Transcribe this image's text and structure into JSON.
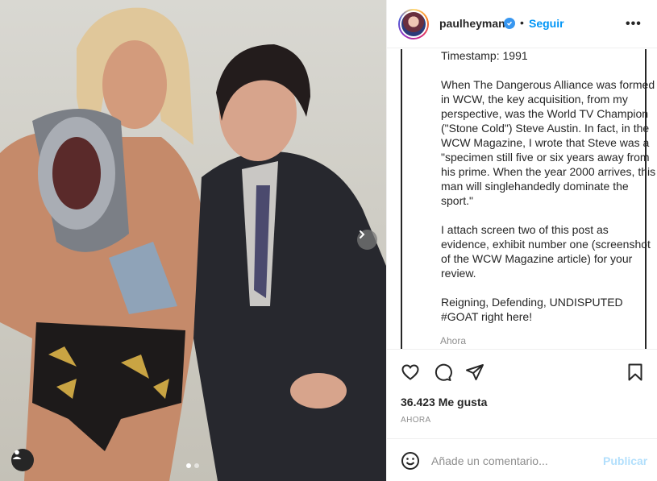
{
  "post": {
    "image_alt": "Two men posing; one holding a championship belt",
    "carousel_dots": 2,
    "active_dot": 0
  },
  "header": {
    "username": "paulheyman",
    "verified": true,
    "separator": "•",
    "follow_label": "Seguir",
    "more_label": "•••"
  },
  "caption": {
    "text": "Timestamp: 1991\n\nWhen The Dangerous Alliance was formed in WCW, the key acquisition, from my perspective, was the World TV Champion (\"Stone Cold\") Steve Austin. In fact, in the WCW Magazine, I wrote that Steve was a \"specimen still five or six years away from his prime. When the year 2000 arrives, this man will singlehandedly dominate the sport.\"\n\nI attach screen two of this post as evidence, exhibit number one (screenshot of the WCW Magazine article) for your review.\n\nReigning, Defending, UNDISPUTED #GOAT right here!",
    "time": "Ahora"
  },
  "actions": {
    "like_icon": "heart-icon",
    "comment_icon": "comment-icon",
    "share_icon": "share-icon",
    "save_icon": "bookmark-icon"
  },
  "likes": "36.423 Me gusta",
  "posted_ago": "AHORA",
  "comment": {
    "placeholder": "Añade un comentario...",
    "value": "",
    "publish_label": "Publicar"
  },
  "colors": {
    "accent": "#0095f6",
    "verified": "#3897f0",
    "publish_disabled": "#b2dffc",
    "muted": "#8e8e8e"
  }
}
